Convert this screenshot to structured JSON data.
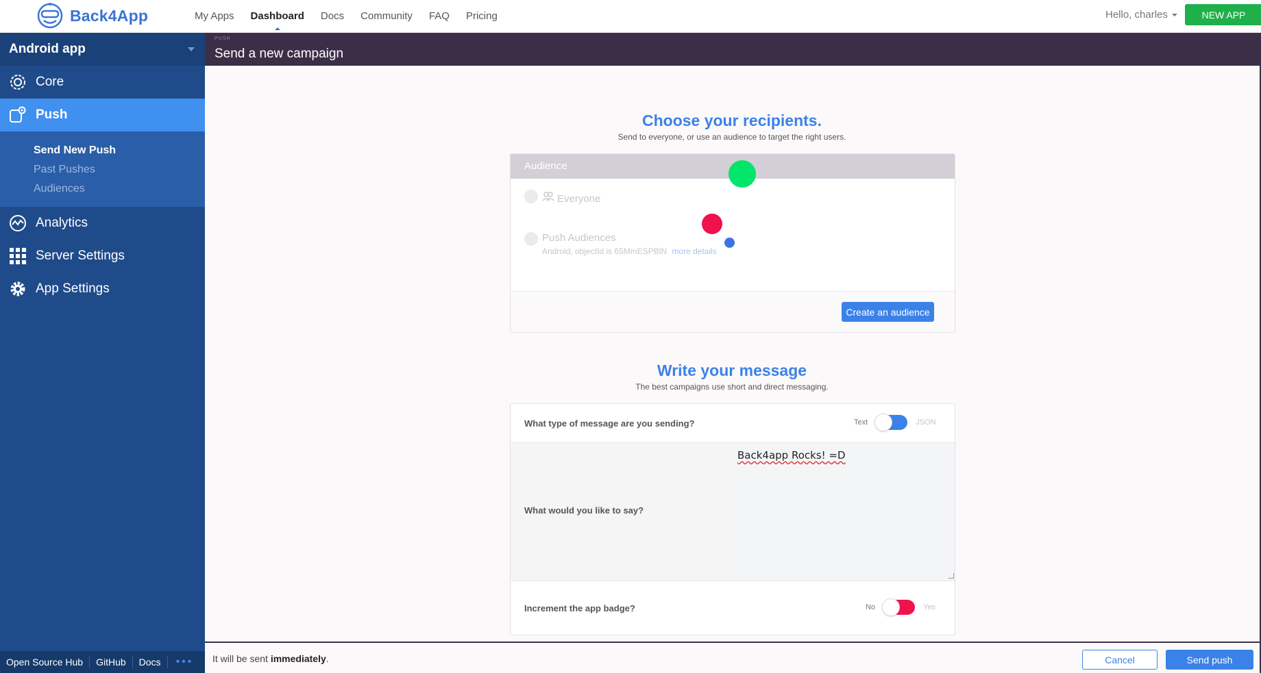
{
  "nav": {
    "brand": "Back4App",
    "links": [
      "My Apps",
      "Dashboard",
      "Docs",
      "Community",
      "FAQ",
      "Pricing"
    ],
    "active_link": "Dashboard",
    "greeting": "Hello, charles",
    "new_app": "NEW APP"
  },
  "sidebar": {
    "app_name": "Android app",
    "items": [
      {
        "label": "Core",
        "icon": "gear-cluster-icon"
      },
      {
        "label": "Push",
        "icon": "push-notification-icon"
      },
      {
        "label": "Analytics",
        "icon": "analytics-icon"
      },
      {
        "label": "Server Settings",
        "icon": "grid-icon"
      },
      {
        "label": "App Settings",
        "icon": "gear-icon"
      }
    ],
    "push_subitems": [
      "Send New Push",
      "Past Pushes",
      "Audiences"
    ],
    "footer_links": [
      "Open Source Hub",
      "GitHub",
      "Docs"
    ],
    "footer_more": "•••"
  },
  "header": {
    "section": "PUSH",
    "title": "Send a new campaign"
  },
  "recipients": {
    "title": "Choose your recipients.",
    "subtitle": "Send to everyone, or use an audience to target the right users.",
    "panel_title": "Audience",
    "everyone": "Everyone",
    "push_audiences": "Push Audiences",
    "audience_detail": "Android, objectId is 65MmESPBlN",
    "more_details": "more details",
    "create_audience": "Create an audience"
  },
  "message": {
    "title": "Write your message",
    "subtitle": "The best campaigns use short and direct messaging.",
    "type_question": "What type of message are you sending?",
    "type_left": "Text",
    "type_right": "JSON",
    "say_question": "What would you like to say?",
    "say_value": "Back4app Rocks! =D",
    "badge_question": "Increment the app badge?",
    "badge_left": "No",
    "badge_right": "Yes"
  },
  "footer": {
    "schedule_prefix": "It will be sent",
    "schedule_value": "immediately",
    "schedule_suffix": ".",
    "cancel": "Cancel",
    "send": "Send push"
  },
  "colors": {
    "accent": "#3b82e8",
    "sidebar": "#1f4b8a",
    "header": "#3d2e47",
    "green": "#20b04b",
    "badge_toggle": "#f0134a"
  }
}
